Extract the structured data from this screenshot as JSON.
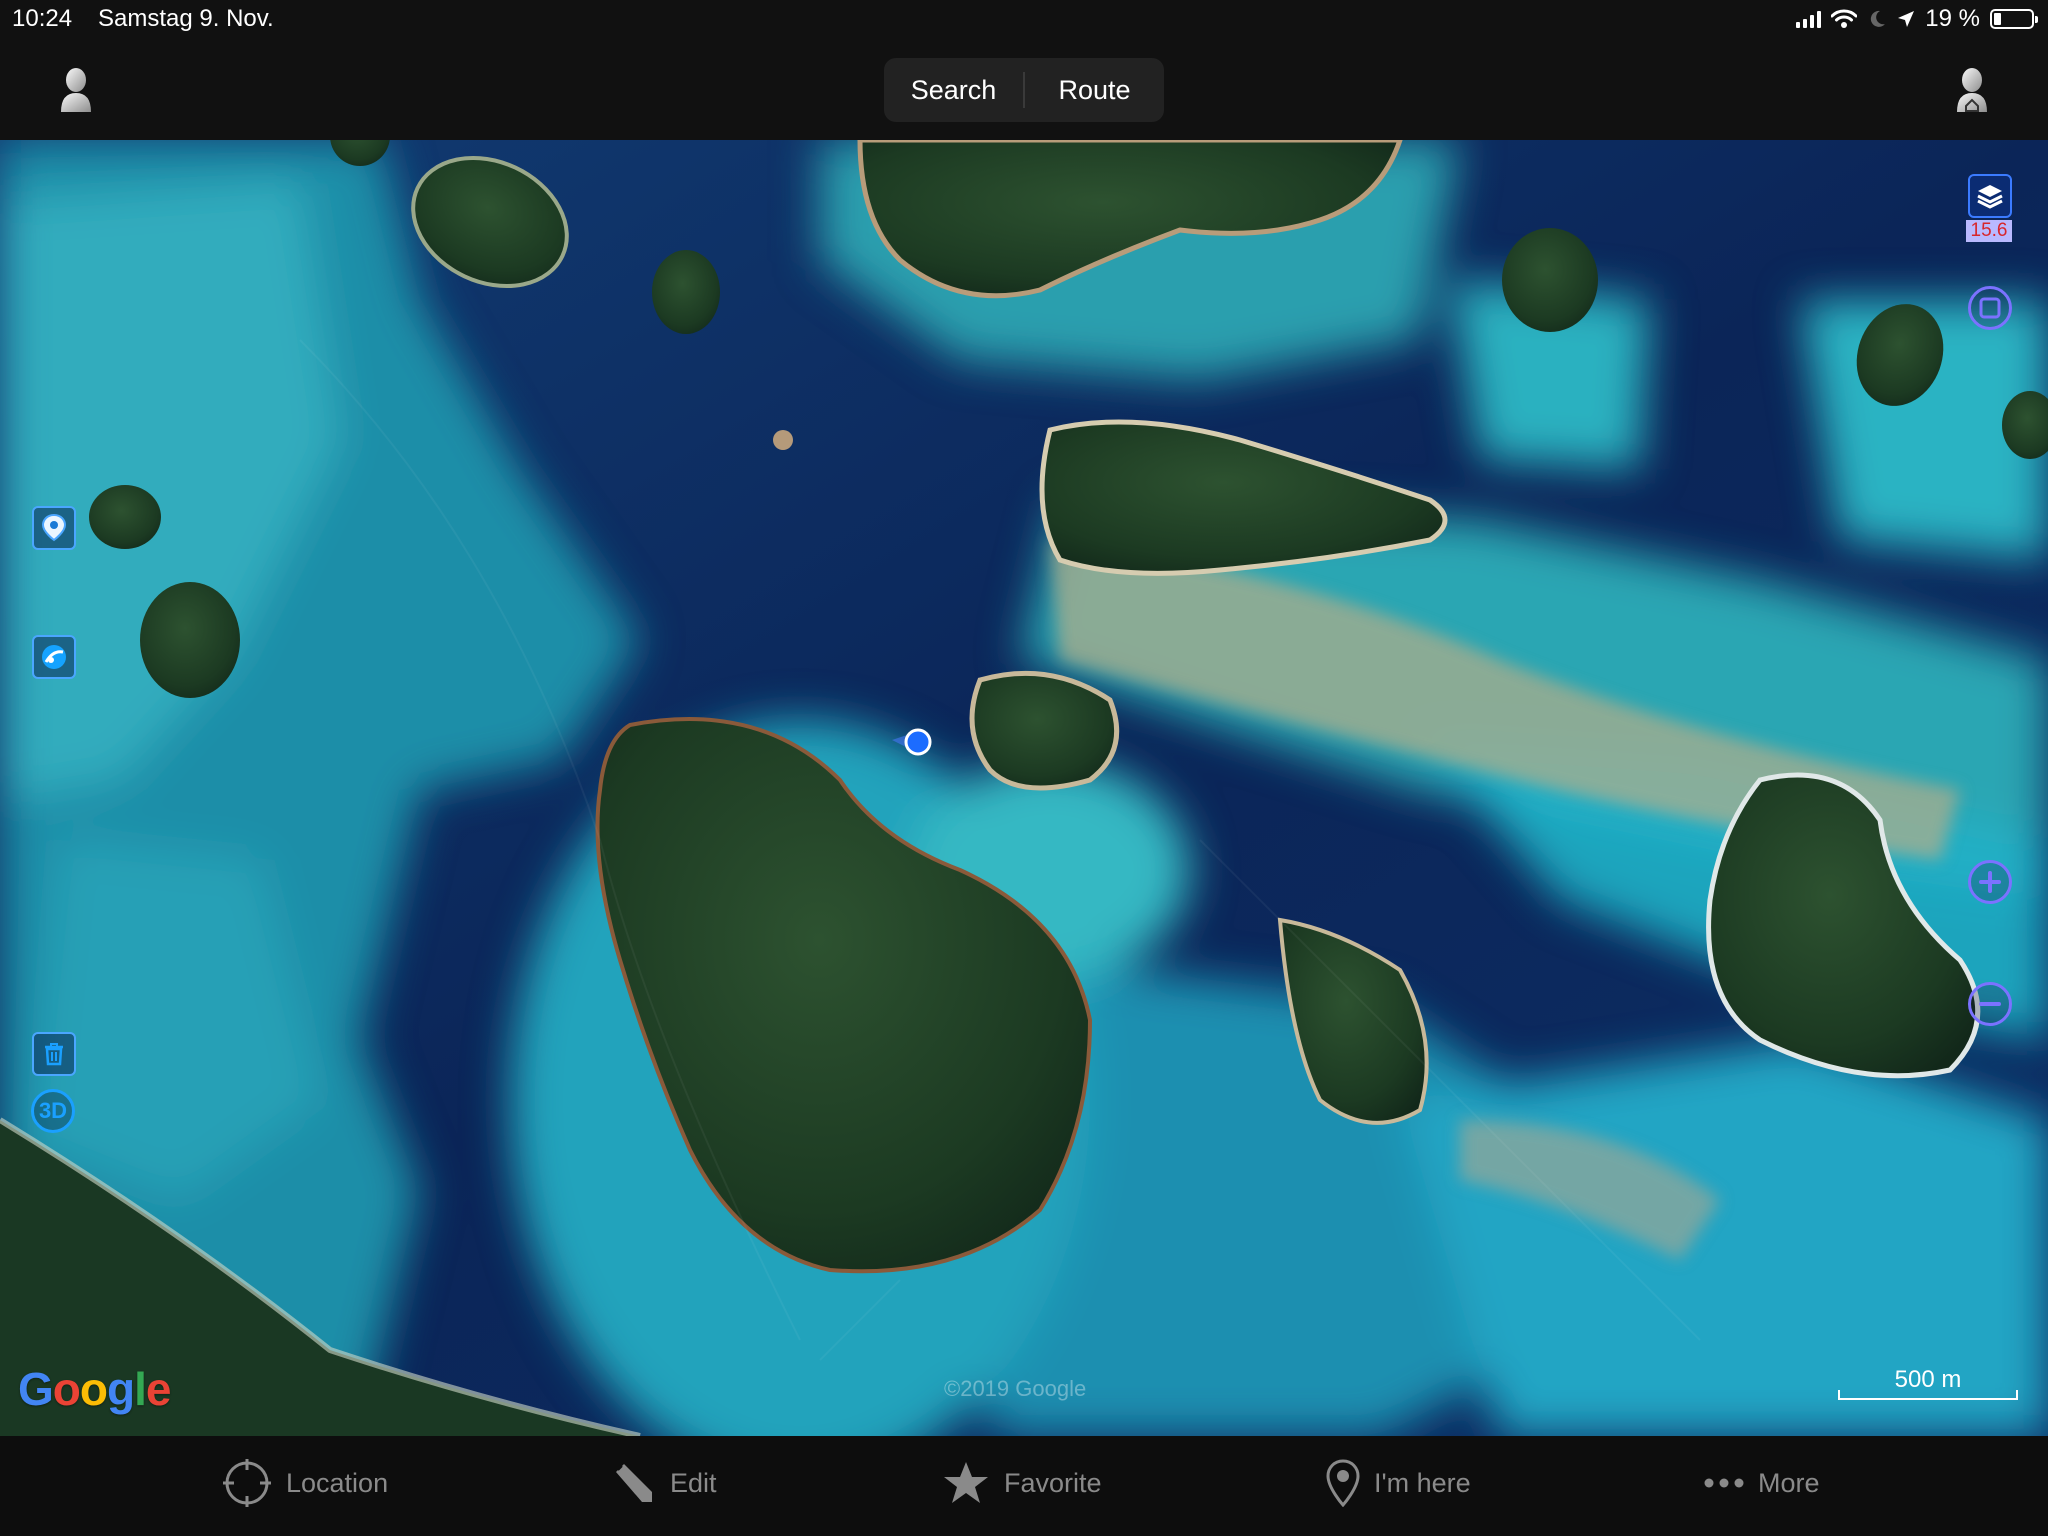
{
  "status_bar": {
    "time": "10:24",
    "date": "Samstag 9. Nov.",
    "battery": "19 %",
    "battery_level": 0.19,
    "icons": [
      "cellular-signal-icon",
      "wifi-icon",
      "moon-icon",
      "location-arrow-icon",
      "battery-icon"
    ]
  },
  "header": {
    "segments": [
      {
        "label": "Search"
      },
      {
        "label": "Route"
      }
    ],
    "left_icon": "person-icon",
    "right_icon": "person-home-icon"
  },
  "map": {
    "zoom_level": "15.6",
    "copyright": "©2019 Google",
    "logo_text": "Google",
    "logo_colors": [
      "#4285F4",
      "#EA4335",
      "#FBBC05",
      "#4285F4",
      "#34A853",
      "#EA4335"
    ],
    "scale": "500 m",
    "left_tools": [
      "map-pin-icon",
      "track-icon",
      "trash-icon",
      "3d-icon"
    ],
    "btn_3d": "3D",
    "right_tools": [
      "layers-icon",
      "square-frame-icon",
      "zoom-in-icon",
      "zoom-out-icon"
    ]
  },
  "tab_bar": {
    "items": [
      {
        "label": "Location",
        "icon": "crosshair-icon"
      },
      {
        "label": "Edit",
        "icon": "pencil-icon"
      },
      {
        "label": "Favorite",
        "icon": "star-icon"
      },
      {
        "label": "I'm here",
        "icon": "pin-icon"
      },
      {
        "label": "More",
        "icon": "more-dots-icon"
      }
    ]
  },
  "colors": {
    "deep_water": "#0b1f4a",
    "lagoon": "#1aa3b8",
    "reef": "#3fc6c9",
    "forest": "#1e3b24",
    "accent_blue": "#1aa0ff",
    "accent_violet": "#7b72ff"
  }
}
